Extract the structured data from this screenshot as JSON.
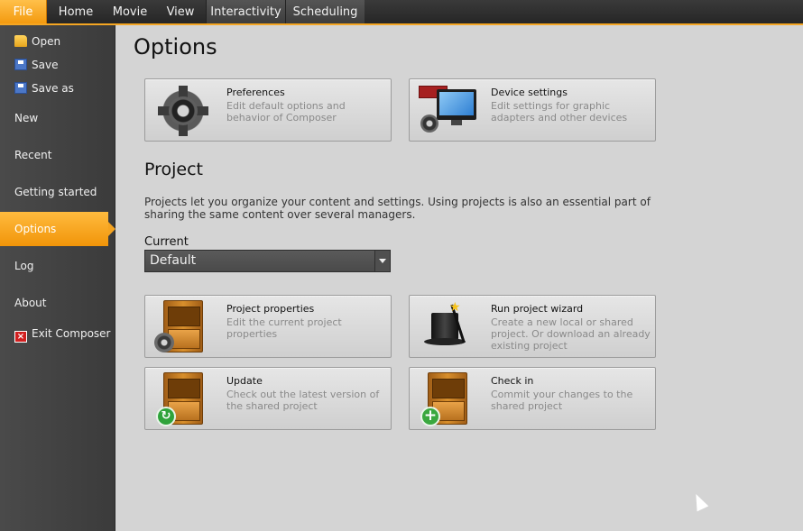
{
  "tabs": [
    "File",
    "Home",
    "Movie",
    "View",
    "Interactivity",
    "Scheduling"
  ],
  "sidebar": {
    "small_items": [
      {
        "label": "Open",
        "icon": "folder-open-icon"
      },
      {
        "label": "Save",
        "icon": "floppy-disk-icon"
      },
      {
        "label": "Save as",
        "icon": "floppy-disk-icon"
      }
    ],
    "items": [
      {
        "label": "New"
      },
      {
        "label": "Recent"
      },
      {
        "label": "Getting started"
      },
      {
        "label": "Options",
        "active": true
      },
      {
        "label": "Log"
      },
      {
        "label": "About"
      }
    ],
    "exit": {
      "label": "Exit Composer",
      "icon": "exit-x-icon"
    }
  },
  "main": {
    "title": "Options",
    "cards_top": [
      {
        "title": "Preferences",
        "subtitle": "Edit default options and behavior of Composer",
        "icon": "gear-icon"
      },
      {
        "title": "Device settings",
        "subtitle": "Edit settings for graphic adapters and other devices",
        "icon": "monitor-icon"
      }
    ],
    "project": {
      "title": "Project",
      "description": "Projects let you organize your content and settings. Using projects is also an essential part of sharing the same content over several managers.",
      "current_label": "Current",
      "current_value": "Default"
    },
    "cards_project": [
      {
        "title": "Project properties",
        "subtitle": "Edit the current project properties",
        "icon": "file-cabinet-gear-icon"
      },
      {
        "title": "Run project wizard",
        "subtitle": "Create a new local or shared project. Or download an already existing project",
        "icon": "magic-hat-icon"
      },
      {
        "title": "Update",
        "subtitle": "Check out the latest version of the shared project",
        "icon": "file-cabinet-refresh-icon"
      },
      {
        "title": "Check in",
        "subtitle": "Commit your changes to the shared project",
        "icon": "file-cabinet-plus-icon"
      }
    ]
  },
  "colors": {
    "accent": "#f5a623",
    "sidebar_bg": "#424242",
    "main_bg": "#d4d4d4"
  }
}
